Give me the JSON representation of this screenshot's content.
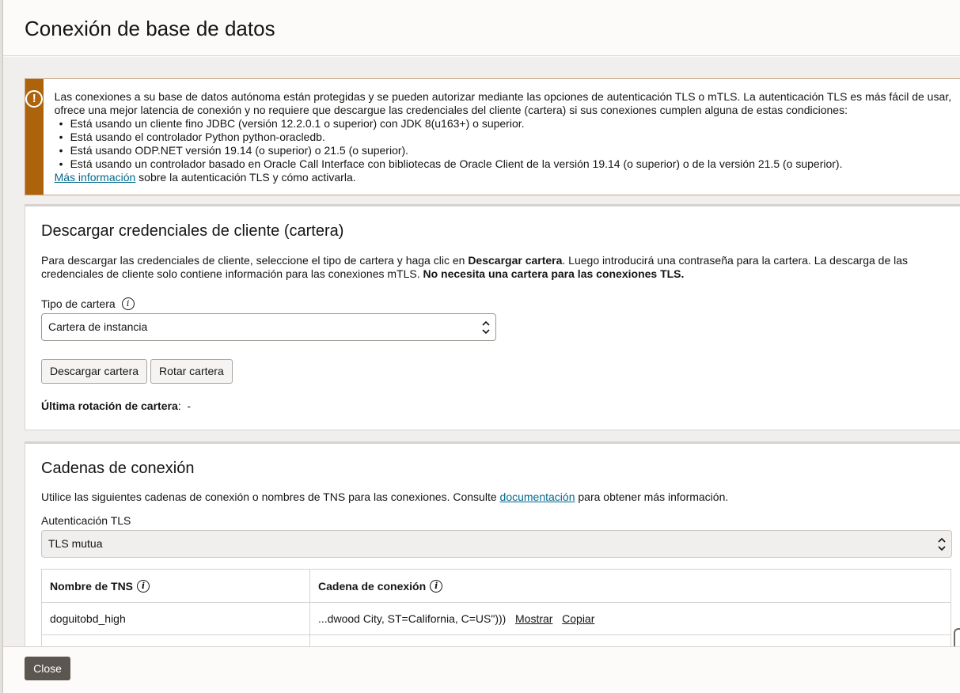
{
  "dialog": {
    "title": "Conexión de base de datos",
    "close_label": "Close"
  },
  "alert": {
    "icon": "exclamation-circle-icon",
    "color": "#ac630c",
    "text": "Las conexiones a su base de datos autónoma están protegidas y se pueden autorizar mediante las opciones de autenticación TLS o mTLS. La autenticación TLS es más fácil de usar, ofrece una mejor latencia de conexión y no requiere que descargue las credenciales del cliente (cartera) si sus conexiones cumplen alguna de estas condiciones:",
    "bullets": [
      "Está usando un cliente fino JDBC (versión 12.2.0.1 o superior) con JDK 8(u163+) o superior.",
      "Está usando el controlador Python python-oracledb.",
      "Está usando ODP.NET versión 19.14 (o superior) o 21.5 (o superior).",
      "Está usando un controlador basado en Oracle Call Interface con bibliotecas de Oracle Client de la versión 19.14 (o superior) o de la versión 21.5 (o superior)."
    ],
    "link_text": "Más información",
    "link_suffix": " sobre la autenticación TLS y cómo activarla."
  },
  "wallet": {
    "title": "Descargar credenciales de cliente (cartera)",
    "desc_part1": "Para descargar las credenciales de cliente, seleccione el tipo de cartera y haga clic en ",
    "desc_bold1": "Descargar cartera",
    "desc_part2": ". Luego introducirá una contraseña para la cartera. La descarga de las credenciales de cliente solo contiene información para las conexiones mTLS. ",
    "desc_bold2": "No necesita una cartera para las conexiones TLS.",
    "type_label": "Tipo de cartera",
    "type_value": "Cartera de instancia",
    "download_button": "Descargar cartera",
    "rotate_button": "Rotar cartera",
    "last_rotation_label": "Última rotación de cartera",
    "last_rotation_value": "-"
  },
  "connections": {
    "title": "Cadenas de conexión",
    "desc_prefix": "Utilice las siguientes cadenas de conexión o nombres de TNS para las conexiones. Consulte ",
    "desc_link": "documentación",
    "desc_suffix": " para obtener más información.",
    "auth_label": "Autenticación TLS",
    "auth_value": "TLS mutua",
    "columns": [
      "Nombre de TNS",
      "Cadena de conexión"
    ],
    "rows": [
      {
        "name": "doguitobd_high",
        "connection": "...dwood City, ST=California, C=US\")))",
        "show": "Mostrar",
        "copy": "Copiar"
      }
    ]
  }
}
